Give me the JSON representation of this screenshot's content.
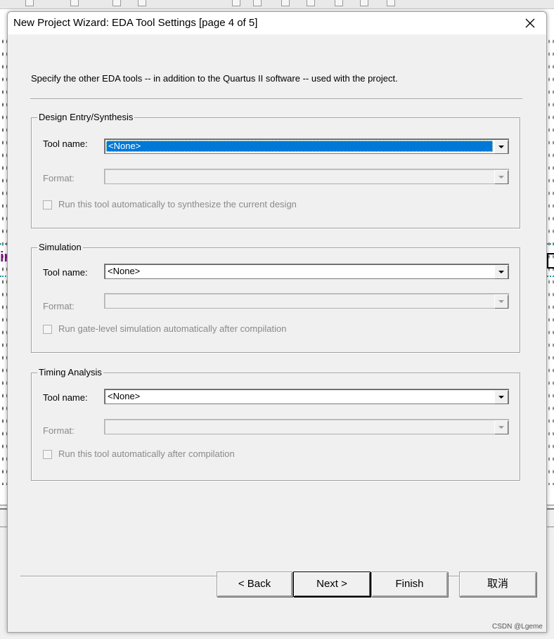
{
  "dialog": {
    "title": "New Project Wizard: EDA Tool Settings [page 4 of 5]",
    "description": "Specify the other EDA tools -- in addition to the Quartus II software -- used with the project."
  },
  "groups": {
    "design_entry": {
      "title": "Design Entry/Synthesis",
      "tool_label": "Tool name:",
      "tool_value": "<None>",
      "format_label": "Format:",
      "format_value": "",
      "checkbox_label": "Run this tool automatically to synthesize the current design",
      "checked": false
    },
    "simulation": {
      "title": "Simulation",
      "tool_label": "Tool name:",
      "tool_value": "<None>",
      "format_label": "Format:",
      "format_value": "",
      "checkbox_label": "Run gate-level simulation automatically after compilation",
      "checked": false
    },
    "timing": {
      "title": "Timing Analysis",
      "tool_label": "Tool name:",
      "tool_value": "<None>",
      "format_label": "Format:",
      "format_value": "",
      "checkbox_label": "Run this tool automatically after compilation",
      "checked": false
    }
  },
  "buttons": {
    "back": "< Back",
    "next": "Next >",
    "finish": "Finish",
    "cancel": "取消"
  },
  "background": {
    "left_glyph": "in"
  },
  "watermark": "CSDN @Lgeme",
  "colors": {
    "selection": "#0078d7",
    "disabled_text": "#8a8a8a",
    "dialog_bg": "#f0f0f0"
  }
}
